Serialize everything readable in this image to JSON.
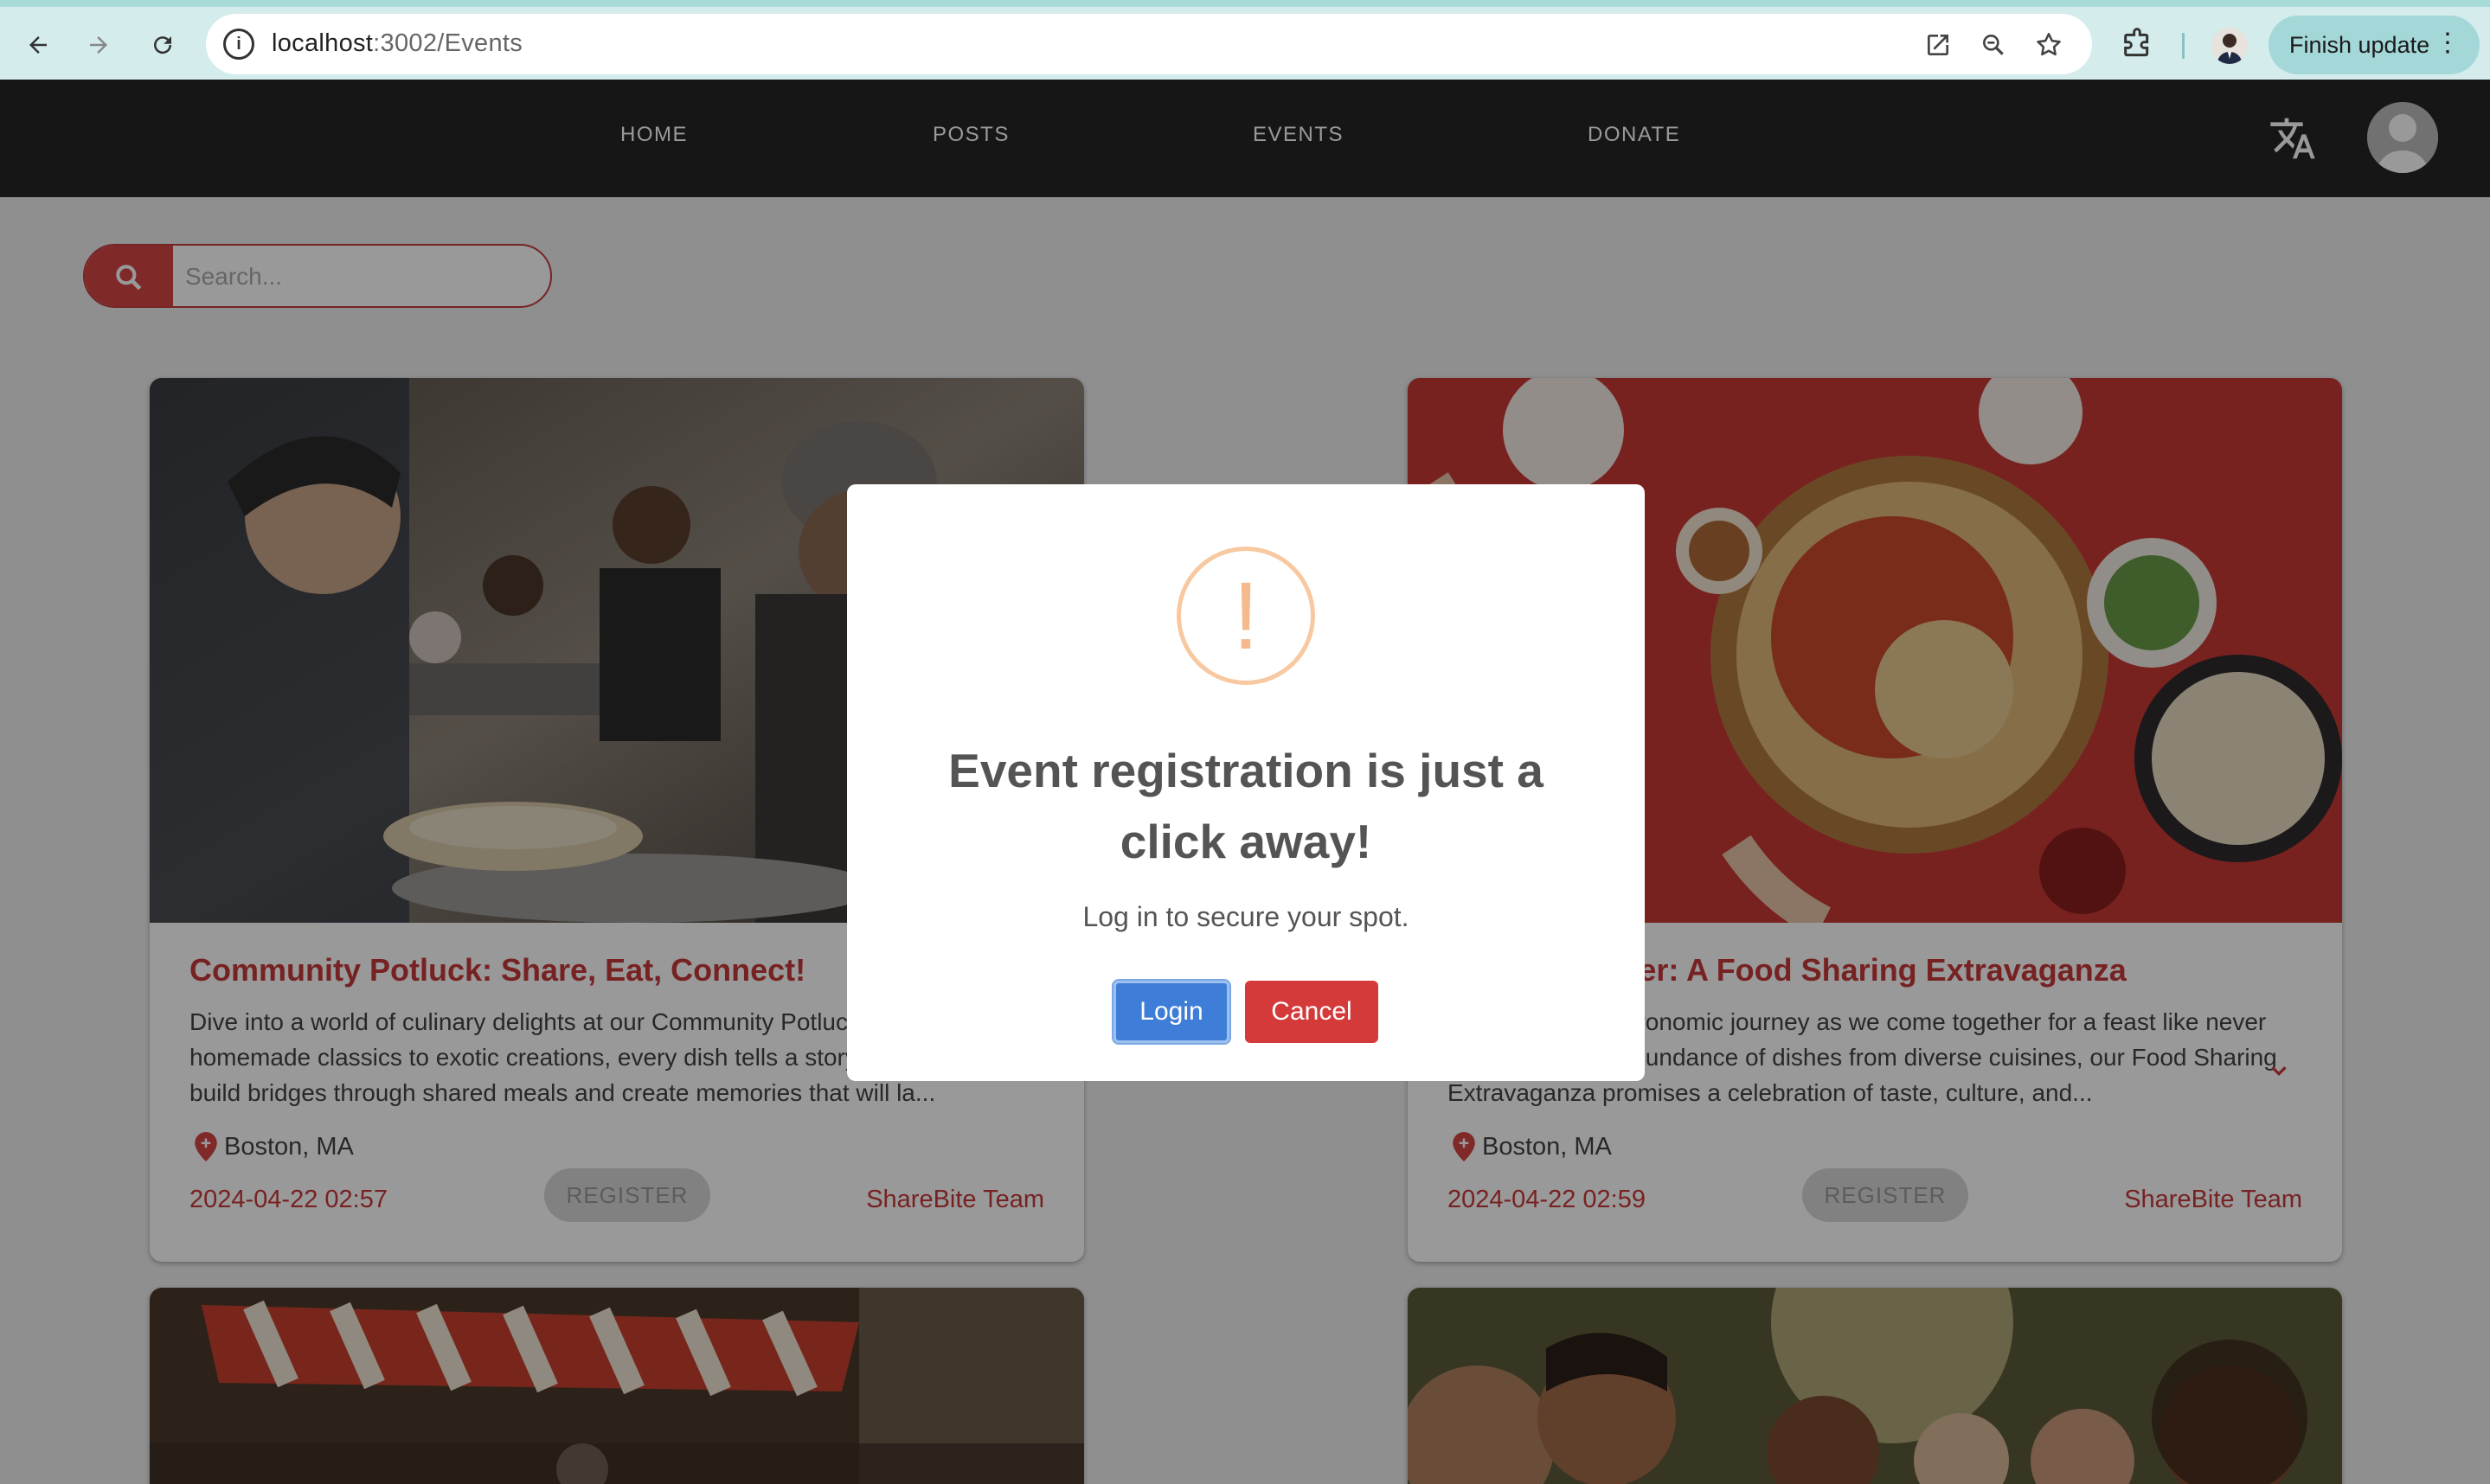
{
  "browser": {
    "url_host": "localhost",
    "url_path": ":3002/Events",
    "finish_update_label": "Finish update",
    "more_label": "⋮"
  },
  "navbar": {
    "items": [
      {
        "label": "HOME"
      },
      {
        "label": "POSTS"
      },
      {
        "label": "EVENTS"
      },
      {
        "label": "DONATE"
      }
    ]
  },
  "search": {
    "placeholder": "Search..."
  },
  "events": [
    {
      "title": "Community Potluck: Share, Eat, Connect!",
      "description": "Dive into a world of culinary delights at our Community Potluck! From homemade classics to exotic creations, every dish tells a story. Join us to build bridges through shared meals and create memories that will la...",
      "location": "Boston, MA",
      "date": "2024-04-22 02:57",
      "register_label": "REGISTER",
      "author": "ShareBite Team"
    },
    {
      "title": "Feast Together: A Food Sharing Extravaganza",
      "description": "Embark on a gastronomic journey as we come together for a feast like never before. With an abundance of dishes from diverse cuisines, our Food Sharing Extravaganza promises a celebration of taste, culture, and...",
      "location": "Boston, MA",
      "date": "2024-04-22 02:59",
      "register_label": "REGISTER",
      "author": "ShareBite Team"
    }
  ],
  "modal": {
    "icon_glyph": "!",
    "heading": "Event registration is just a click away!",
    "message": "Log in to secure your spot.",
    "login_label": "Login",
    "cancel_label": "Cancel"
  },
  "colors": {
    "accent_red": "#c63a3a",
    "login_blue": "#3f7ed8",
    "warning_orange": "#f8c8a0",
    "navbar_bg": "#262626"
  }
}
